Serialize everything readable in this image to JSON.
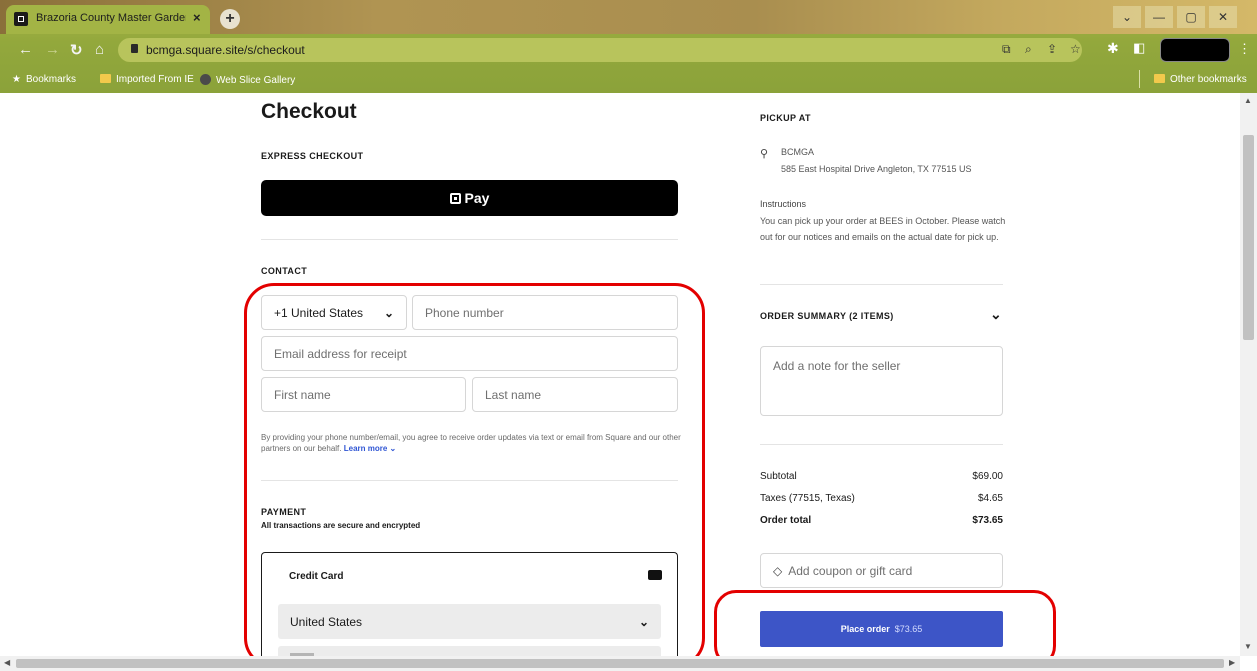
{
  "browser": {
    "tab_title": "Brazoria County Master Gardene",
    "tab_close": "×",
    "new_tab": "+",
    "url": "bcmga.square.site/s/checkout",
    "bookmarks": [
      "Bookmarks",
      "Imported From IE",
      "Web Slice Gallery"
    ],
    "other_bookmarks": "Other bookmarks"
  },
  "checkout": {
    "title": "Checkout",
    "express_label": "EXPRESS CHECKOUT",
    "pay_button": "Pay",
    "contact_label": "CONTACT",
    "country_code": "+1 United States",
    "phone_placeholder": "Phone number",
    "email_placeholder": "Email address for receipt",
    "first_name_placeholder": "First name",
    "last_name_placeholder": "Last name",
    "consent_text": "By providing your phone number/email, you agree to receive order updates via text or email from Square and our other partners on our behalf.",
    "learn_more": "Learn more",
    "payment_label": "PAYMENT",
    "payment_subtitle": "All transactions are secure and encrypted",
    "credit_card_label": "Credit Card",
    "country_select": "United States"
  },
  "pickup": {
    "label": "PICKUP AT",
    "name": "BCMGA",
    "address": "585 East Hospital Drive Angleton, TX 77515 US",
    "instructions_label": "Instructions",
    "instructions": "You can pick up your order at BEES in October. Please watch out for our notices and emails on the actual date for pick up."
  },
  "summary": {
    "order_summary_label": "ORDER SUMMARY (2 ITEMS)",
    "note_placeholder": "Add a note for the seller",
    "subtotal_label": "Subtotal",
    "subtotal_value": "$69.00",
    "taxes_label": "Taxes (77515, Texas)",
    "taxes_value": "$4.65",
    "total_label": "Order total",
    "total_value": "$73.65",
    "coupon_placeholder": "Add coupon or gift card",
    "place_order_label": "Place order",
    "place_order_amount": "$73.65"
  },
  "colors": {
    "place_order_bg": "#3d55c7",
    "annotation": "#e30000",
    "link": "#2f55d4"
  }
}
